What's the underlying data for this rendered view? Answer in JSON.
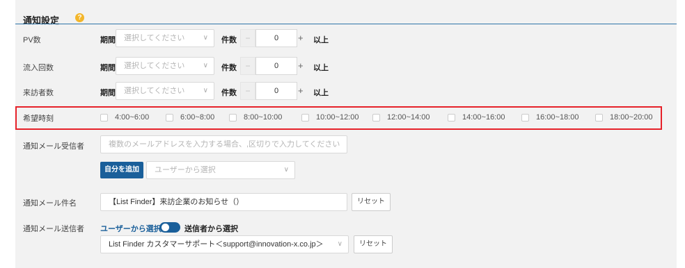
{
  "section": {
    "title": "通知設定",
    "help_icon": "?"
  },
  "rows": {
    "pv": {
      "label": "PV数"
    },
    "inflow": {
      "label": "流入回数"
    },
    "visitors": {
      "label": "来訪者数"
    }
  },
  "period_label": "期間",
  "select_placeholder": "選択してください",
  "count_label": "件数",
  "count_value": "0",
  "minus": "−",
  "plus": "+",
  "above_label": "以上",
  "chevron": "∨",
  "time": {
    "label": "希望時刻",
    "slots": [
      "4:00~6:00",
      "6:00~8:00",
      "8:00~10:00",
      "10:00~12:00",
      "12:00~14:00",
      "14:00~16:00",
      "16:00~18:00",
      "18:00~20:00"
    ]
  },
  "recipients": {
    "label": "通知メール受信者",
    "placeholder": "複数のメールアドレスを入力する場合、,区切りで入力してください",
    "add_self_button": "自分を追加",
    "user_select_placeholder": "ユーザーから選択"
  },
  "subject": {
    "label": "通知メール件名",
    "value": "【List Finder】来訪企業のお知らせ（）",
    "reset": "リセット"
  },
  "sender": {
    "label": "通知メール送信者",
    "from_user": "ユーザーから選択",
    "from_sender": "送信者から選択",
    "toggle_on": true,
    "selected": "List Finder カスタマーサポート＜support@innovation-x.co.jp＞",
    "reset": "リセット"
  },
  "colors": {
    "accent": "#1a5f9a",
    "highlight": "#e62129",
    "help": "#f3b62b"
  }
}
